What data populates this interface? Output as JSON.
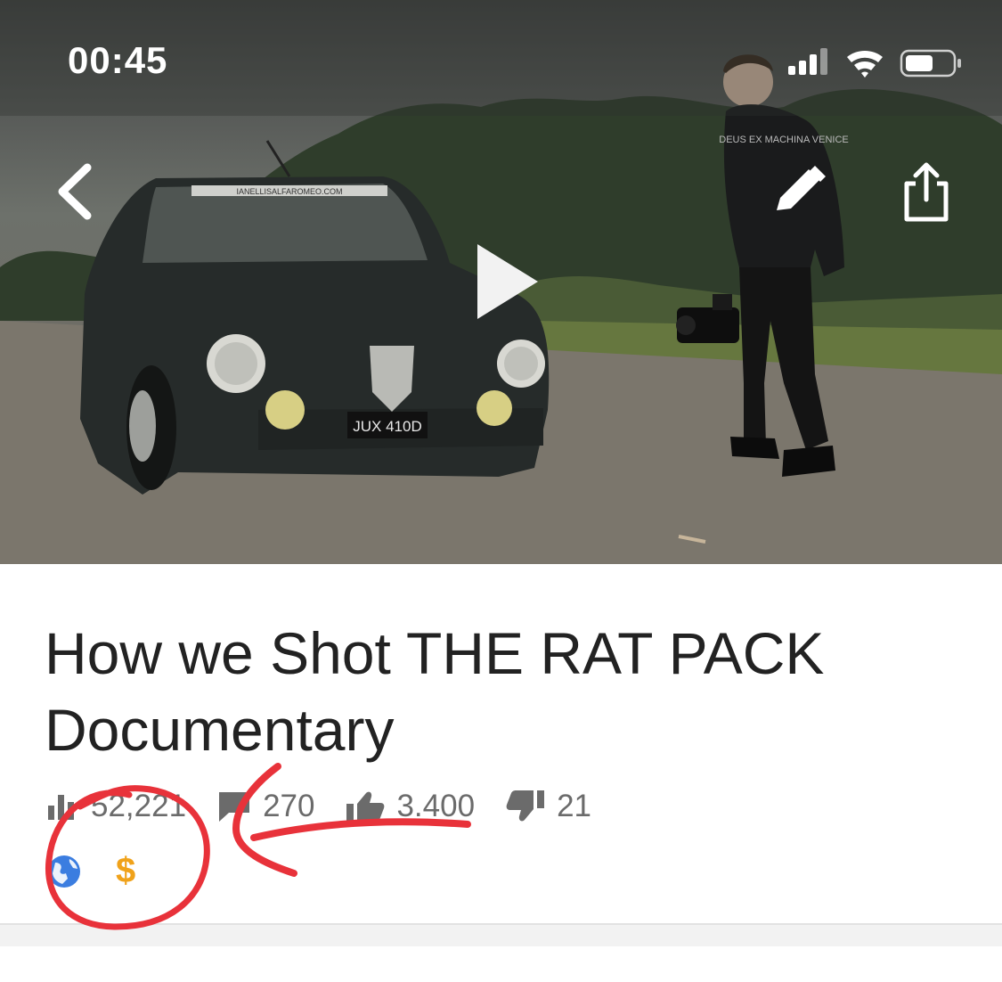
{
  "status_bar": {
    "time": "00:45",
    "icons": [
      "cellular-signal-icon",
      "wifi-icon",
      "battery-icon"
    ]
  },
  "photo": {
    "license_plate": "JUX 410D",
    "windshield_sticker": "IANELLISALFAROMEO.COM",
    "shirt_print": "DEUS EX MACHINA VENICE"
  },
  "toolbar": {
    "back_icon": "chevron-left-icon",
    "edit_icon": "pencil-icon",
    "share_icon": "share-icon",
    "play_icon": "play-icon"
  },
  "video": {
    "title": "How we Shot THE RAT PACK Documentary",
    "stats": {
      "views": "52,221",
      "comments": "270",
      "likes": "3.400",
      "dislikes": "21"
    },
    "visibility_icon": "globe-icon",
    "monetization_label": "$"
  },
  "colors": {
    "annotation": "#e8323a",
    "monetization": "#f0a21a",
    "globe": "#3b7de0"
  }
}
